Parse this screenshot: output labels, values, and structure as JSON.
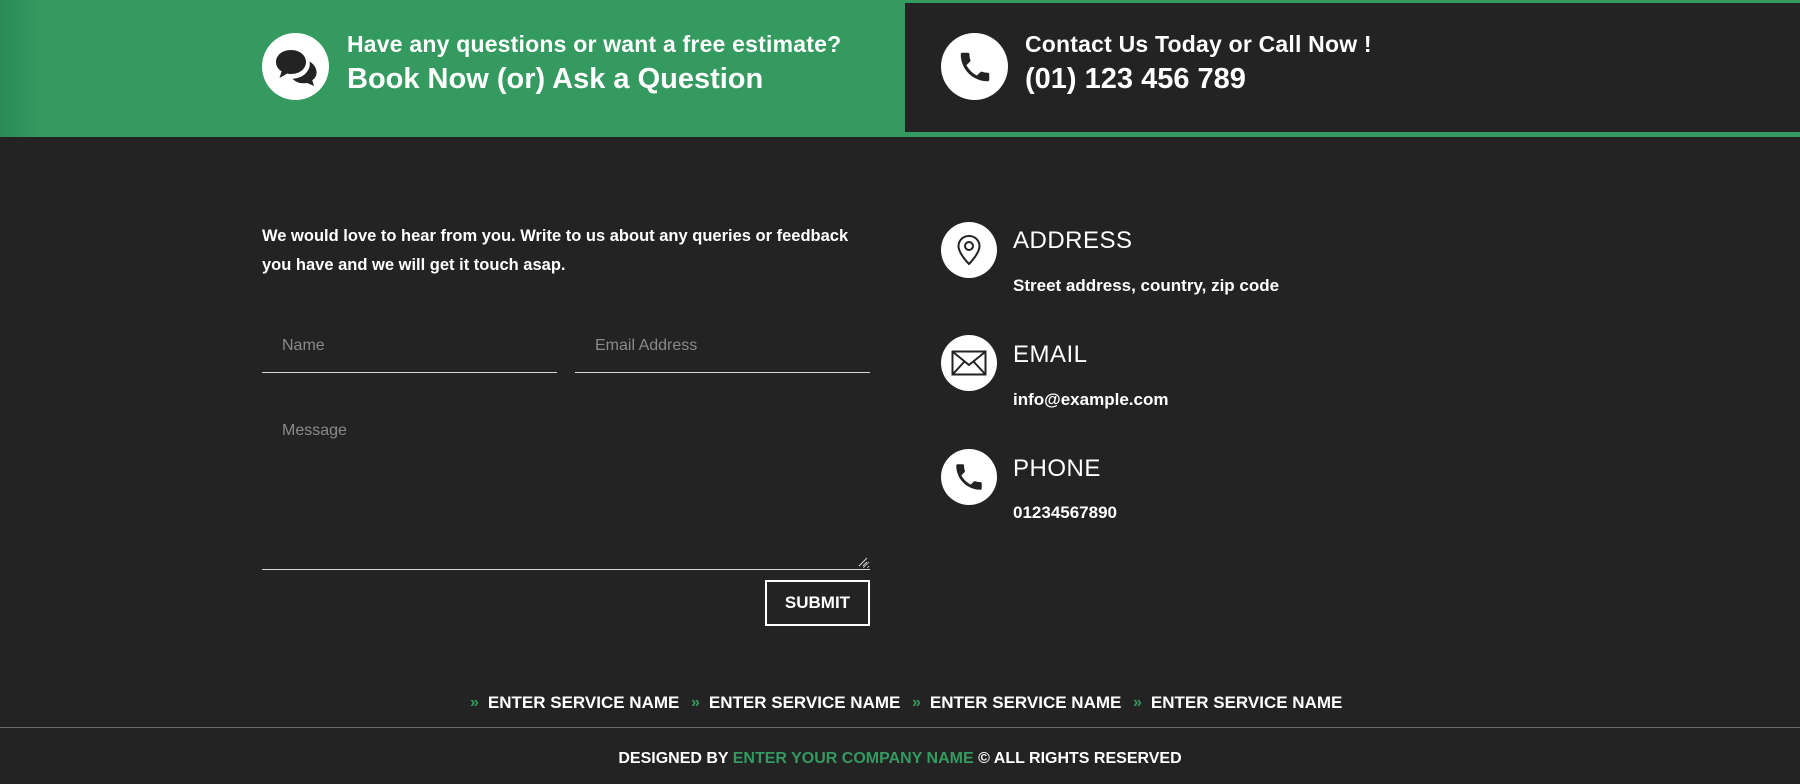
{
  "banner": {
    "left": {
      "icon": "chat-bubbles-icon",
      "kicker": "Have any questions or want a free estimate?",
      "headline": "Book Now (or) Ask a Question"
    },
    "right": {
      "icon": "phone-icon",
      "kicker": "Contact Us Today or Call Now !",
      "headline": "(01) 123 456 789"
    }
  },
  "form": {
    "intro": "We would love to hear from you. Write to us about any queries or feedback you have and we will get it touch asap.",
    "name_placeholder": "Name",
    "email_placeholder": "Email Address",
    "message_placeholder": "Message",
    "submit_label": "SUBMIT"
  },
  "contact_info": [
    {
      "icon": "location-pin-icon",
      "title": "ADDRESS",
      "value": "Street address, country, zip code"
    },
    {
      "icon": "envelope-icon",
      "title": "EMAIL",
      "value": "info@example.com"
    },
    {
      "icon": "phone-icon",
      "title": "PHONE",
      "value": "01234567890"
    }
  ],
  "services": [
    "ENTER SERVICE NAME",
    "ENTER SERVICE NAME",
    "ENTER SERVICE NAME",
    "ENTER SERVICE NAME"
  ],
  "footer": {
    "designed_by": "DESIGNED BY",
    "company": "ENTER YOUR COMPANY NAME",
    "rights": "© ALL RIGHTS RESERVED"
  },
  "colors": {
    "accent_green": "#349a60",
    "background": "#232323",
    "text": "#ffffff"
  }
}
